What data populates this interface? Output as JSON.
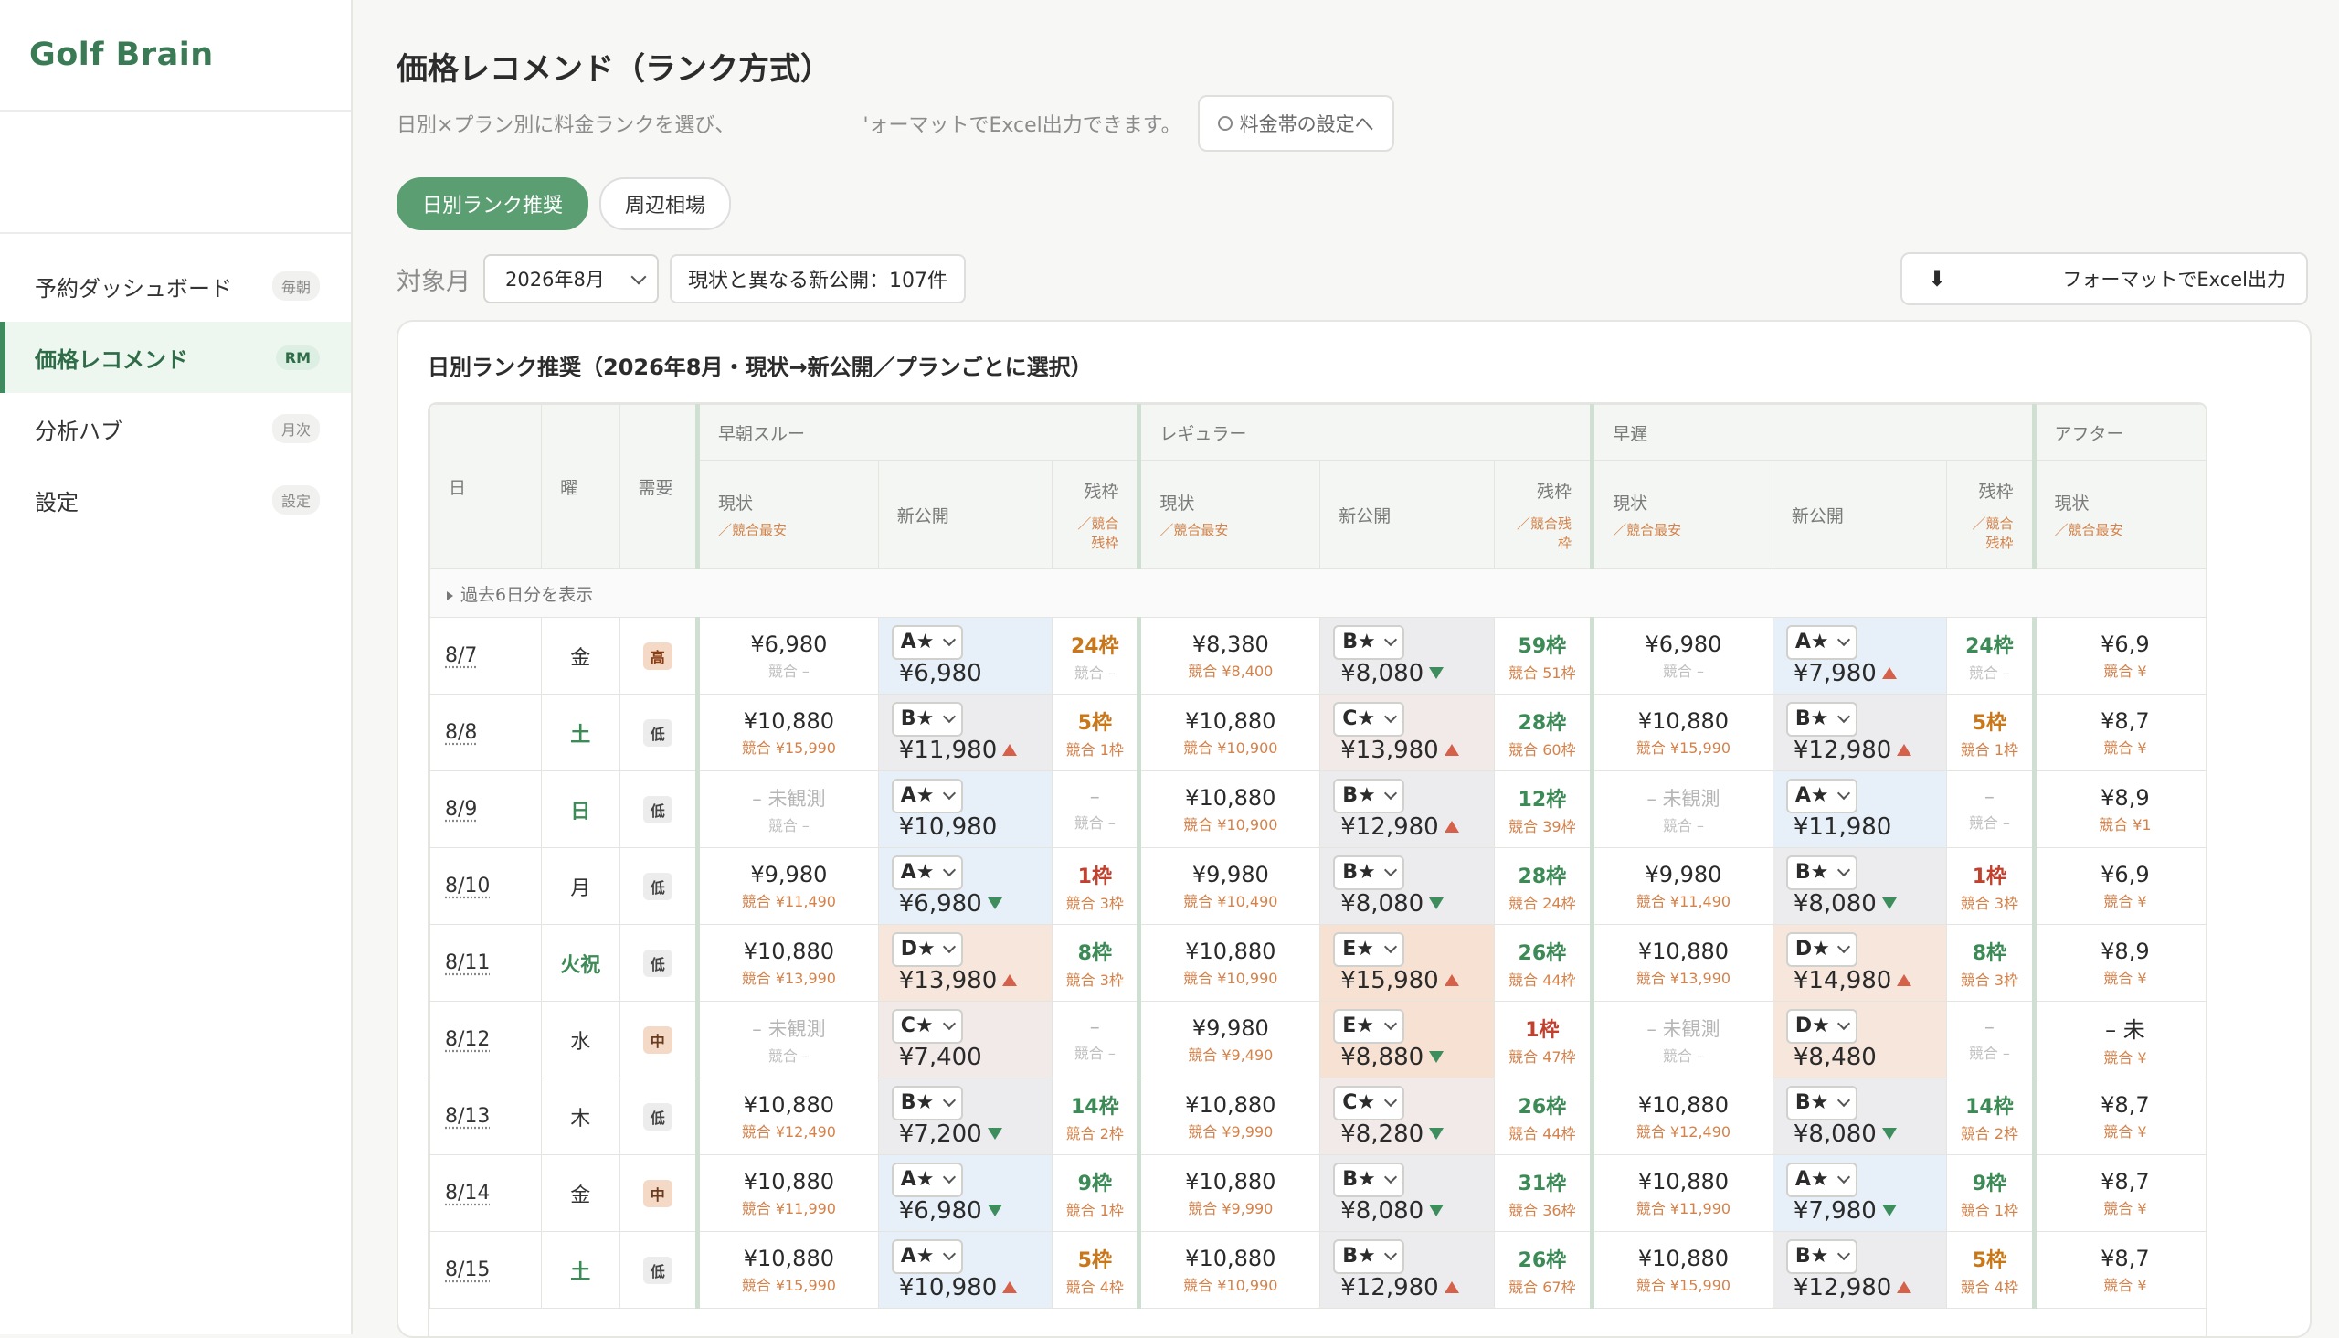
{
  "sidebar": {
    "brand": "Golf Brain",
    "nav": [
      {
        "label": "予約ダッシュボード",
        "badge": "毎朝"
      },
      {
        "label": "価格レコメンド",
        "badge": "RM"
      },
      {
        "label": "分析ハブ",
        "badge": "月次"
      },
      {
        "label": "設定",
        "badge": "設定"
      }
    ]
  },
  "header": {
    "title": "価格レコメンド（ランク方式）",
    "subtitle_part1": "日別×プラン別に料金ランクを選び、",
    "subtitle_part2": "'ォーマットでExcel出力できます。",
    "settings_link": "料金帯の設定へ"
  },
  "tabs": [
    "日別ランク推奨",
    "周辺相場"
  ],
  "filters": {
    "month_label": "対象月",
    "month_value": "2026年8月",
    "new_count": "現状と異なる新公開：107件",
    "export_label": "フォーマットでExcel出力"
  },
  "card": {
    "title": "日別ランク推奨（2026年8月・現状→新公開／プランごとに選択）",
    "head_day": "日",
    "head_dow": "曜",
    "head_demand": "需要",
    "plans": [
      "早朝スルー",
      "レギュラー",
      "早遅",
      "アフター"
    ],
    "sub_current": "現状",
    "sub_current_note": "／競合最安",
    "sub_new": "新公開",
    "sub_remain": "残枠",
    "sub_remain_note": "／競合残枠",
    "collapse_label": "過去6日分を表示"
  },
  "rows": [
    {
      "date": "8/7",
      "dow": "金",
      "dow_color": "",
      "demand": "高",
      "dem_level": "high",
      "p": [
        {
          "cur": "¥6,980",
          "cur_muted": false,
          "comp": "競合 –",
          "comp_muted": true,
          "rank": "A★",
          "tint": "a",
          "price": "¥6,980",
          "arrow": "",
          "rem": "24枠",
          "rem_color": "orange",
          "rem_sub": "競合 –",
          "rem_sub_muted": true
        },
        {
          "cur": "¥8,380",
          "cur_muted": false,
          "comp": "競合 ¥8,400",
          "comp_muted": false,
          "rank": "B★",
          "tint": "b",
          "price": "¥8,080",
          "arrow": "down",
          "rem": "59枠",
          "rem_color": "green",
          "rem_sub": "競合 51枠",
          "rem_sub_muted": false
        },
        {
          "cur": "¥6,980",
          "cur_muted": false,
          "comp": "競合 –",
          "comp_muted": true,
          "rank": "A★",
          "tint": "a",
          "price": "¥7,980",
          "arrow": "up",
          "rem": "24枠",
          "rem_color": "green",
          "rem_sub": "競合 –",
          "rem_sub_muted": true
        },
        {
          "cur": "¥6,9",
          "comp": "競合 ¥"
        }
      ]
    },
    {
      "date": "8/8",
      "dow": "土",
      "dow_color": "green",
      "demand": "低",
      "dem_level": "low",
      "p": [
        {
          "cur": "¥10,880",
          "cur_muted": false,
          "comp": "競合 ¥15,990",
          "comp_muted": false,
          "rank": "B★",
          "tint": "b",
          "price": "¥11,980",
          "arrow": "up",
          "rem": "5枠",
          "rem_color": "orange",
          "rem_sub": "競合 1枠",
          "rem_sub_muted": false
        },
        {
          "cur": "¥10,880",
          "cur_muted": false,
          "comp": "競合 ¥10,900",
          "comp_muted": false,
          "rank": "C★",
          "tint": "c",
          "price": "¥13,980",
          "arrow": "up",
          "rem": "28枠",
          "rem_color": "green",
          "rem_sub": "競合 60枠",
          "rem_sub_muted": false
        },
        {
          "cur": "¥10,880",
          "cur_muted": false,
          "comp": "競合 ¥15,990",
          "comp_muted": false,
          "rank": "B★",
          "tint": "b",
          "price": "¥12,980",
          "arrow": "up",
          "rem": "5枠",
          "rem_color": "orange",
          "rem_sub": "競合 1枠",
          "rem_sub_muted": false
        },
        {
          "cur": "¥8,7",
          "comp": "競合 ¥"
        }
      ]
    },
    {
      "date": "8/9",
      "dow": "日",
      "dow_color": "green",
      "demand": "低",
      "dem_level": "low",
      "p": [
        {
          "cur": "– 未観測",
          "cur_muted": true,
          "comp": "競合 –",
          "comp_muted": true,
          "rank": "A★",
          "tint": "a",
          "price": "¥10,980",
          "arrow": "",
          "rem": "–",
          "rem_color": "muted",
          "rem_sub": "競合 –",
          "rem_sub_muted": true
        },
        {
          "cur": "¥10,880",
          "cur_muted": false,
          "comp": "競合 ¥10,900",
          "comp_muted": false,
          "rank": "B★",
          "tint": "b",
          "price": "¥12,980",
          "arrow": "up",
          "rem": "12枠",
          "rem_color": "green",
          "rem_sub": "競合 39枠",
          "rem_sub_muted": false
        },
        {
          "cur": "– 未観測",
          "cur_muted": true,
          "comp": "競合 –",
          "comp_muted": true,
          "rank": "A★",
          "tint": "a",
          "price": "¥11,980",
          "arrow": "",
          "rem": "–",
          "rem_color": "muted",
          "rem_sub": "競合 –",
          "rem_sub_muted": true
        },
        {
          "cur": "¥8,9",
          "comp": "競合 ¥1"
        }
      ]
    },
    {
      "date": "8/10",
      "dow": "月",
      "dow_color": "",
      "demand": "低",
      "dem_level": "low",
      "p": [
        {
          "cur": "¥9,980",
          "cur_muted": false,
          "comp": "競合 ¥11,490",
          "comp_muted": false,
          "rank": "A★",
          "tint": "a",
          "price": "¥6,980",
          "arrow": "down",
          "rem": "1枠",
          "rem_color": "red",
          "rem_sub": "競合 3枠",
          "rem_sub_muted": false
        },
        {
          "cur": "¥9,980",
          "cur_muted": false,
          "comp": "競合 ¥10,490",
          "comp_muted": false,
          "rank": "B★",
          "tint": "b",
          "price": "¥8,080",
          "arrow": "down",
          "rem": "28枠",
          "rem_color": "green",
          "rem_sub": "競合 24枠",
          "rem_sub_muted": false
        },
        {
          "cur": "¥9,980",
          "cur_muted": false,
          "comp": "競合 ¥11,490",
          "comp_muted": false,
          "rank": "B★",
          "tint": "b",
          "price": "¥8,080",
          "arrow": "down",
          "rem": "1枠",
          "rem_color": "red",
          "rem_sub": "競合 3枠",
          "rem_sub_muted": false
        },
        {
          "cur": "¥6,9",
          "comp": "競合 ¥"
        }
      ]
    },
    {
      "date": "8/11",
      "dow": "火祝",
      "dow_color": "green",
      "demand": "低",
      "dem_level": "low",
      "p": [
        {
          "cur": "¥10,880",
          "cur_muted": false,
          "comp": "競合 ¥13,990",
          "comp_muted": false,
          "rank": "D★",
          "tint": "d",
          "price": "¥13,980",
          "arrow": "up",
          "rem": "8枠",
          "rem_color": "green",
          "rem_sub": "競合 3枠",
          "rem_sub_muted": false
        },
        {
          "cur": "¥10,880",
          "cur_muted": false,
          "comp": "競合 ¥10,990",
          "comp_muted": false,
          "rank": "E★",
          "tint": "e",
          "price": "¥15,980",
          "arrow": "up",
          "rem": "26枠",
          "rem_color": "green",
          "rem_sub": "競合 44枠",
          "rem_sub_muted": false
        },
        {
          "cur": "¥10,880",
          "cur_muted": false,
          "comp": "競合 ¥13,990",
          "comp_muted": false,
          "rank": "D★",
          "tint": "d",
          "price": "¥14,980",
          "arrow": "up",
          "rem": "8枠",
          "rem_color": "green",
          "rem_sub": "競合 3枠",
          "rem_sub_muted": false
        },
        {
          "cur": "¥8,9",
          "comp": "競合 ¥"
        }
      ]
    },
    {
      "date": "8/12",
      "dow": "水",
      "dow_color": "",
      "demand": "中",
      "dem_level": "mid",
      "p": [
        {
          "cur": "– 未観測",
          "cur_muted": true,
          "comp": "競合 –",
          "comp_muted": true,
          "rank": "C★",
          "tint": "c",
          "price": "¥7,400",
          "arrow": "",
          "rem": "–",
          "rem_color": "muted",
          "rem_sub": "競合 –",
          "rem_sub_muted": true
        },
        {
          "cur": "¥9,980",
          "cur_muted": false,
          "comp": "競合 ¥9,490",
          "comp_muted": false,
          "rank": "E★",
          "tint": "e",
          "price": "¥8,880",
          "arrow": "down",
          "rem": "1枠",
          "rem_color": "red",
          "rem_sub": "競合 47枠",
          "rem_sub_muted": false
        },
        {
          "cur": "– 未観測",
          "cur_muted": true,
          "comp": "競合 –",
          "comp_muted": true,
          "rank": "D★",
          "tint": "d",
          "price": "¥8,480",
          "arrow": "",
          "rem": "–",
          "rem_color": "muted",
          "rem_sub": "競合 –",
          "rem_sub_muted": true
        },
        {
          "cur": "– 未",
          "comp": "競合 ¥"
        }
      ]
    },
    {
      "date": "8/13",
      "dow": "木",
      "dow_color": "",
      "demand": "低",
      "dem_level": "low",
      "p": [
        {
          "cur": "¥10,880",
          "cur_muted": false,
          "comp": "競合 ¥12,490",
          "comp_muted": false,
          "rank": "B★",
          "tint": "b",
          "price": "¥7,200",
          "arrow": "down",
          "rem": "14枠",
          "rem_color": "green",
          "rem_sub": "競合 2枠",
          "rem_sub_muted": false
        },
        {
          "cur": "¥10,880",
          "cur_muted": false,
          "comp": "競合 ¥9,990",
          "comp_muted": false,
          "rank": "C★",
          "tint": "c",
          "price": "¥8,280",
          "arrow": "down",
          "rem": "26枠",
          "rem_color": "green",
          "rem_sub": "競合 44枠",
          "rem_sub_muted": false
        },
        {
          "cur": "¥10,880",
          "cur_muted": false,
          "comp": "競合 ¥12,490",
          "comp_muted": false,
          "rank": "B★",
          "tint": "b",
          "price": "¥8,080",
          "arrow": "down",
          "rem": "14枠",
          "rem_color": "green",
          "rem_sub": "競合 2枠",
          "rem_sub_muted": false
        },
        {
          "cur": "¥8,7",
          "comp": "競合 ¥"
        }
      ]
    },
    {
      "date": "8/14",
      "dow": "金",
      "dow_color": "",
      "demand": "中",
      "dem_level": "mid",
      "p": [
        {
          "cur": "¥10,880",
          "cur_muted": false,
          "comp": "競合 ¥11,990",
          "comp_muted": false,
          "rank": "A★",
          "tint": "a",
          "price": "¥6,980",
          "arrow": "down",
          "rem": "9枠",
          "rem_color": "green",
          "rem_sub": "競合 1枠",
          "rem_sub_muted": false
        },
        {
          "cur": "¥10,880",
          "cur_muted": false,
          "comp": "競合 ¥9,990",
          "comp_muted": false,
          "rank": "B★",
          "tint": "b",
          "price": "¥8,080",
          "arrow": "down",
          "rem": "31枠",
          "rem_color": "green",
          "rem_sub": "競合 36枠",
          "rem_sub_muted": false
        },
        {
          "cur": "¥10,880",
          "cur_muted": false,
          "comp": "競合 ¥11,990",
          "comp_muted": false,
          "rank": "A★",
          "tint": "a",
          "price": "¥7,980",
          "arrow": "down",
          "rem": "9枠",
          "rem_color": "green",
          "rem_sub": "競合 1枠",
          "rem_sub_muted": false
        },
        {
          "cur": "¥8,7",
          "comp": "競合 ¥"
        }
      ]
    },
    {
      "date": "8/15",
      "dow": "土",
      "dow_color": "green",
      "demand": "低",
      "dem_level": "low",
      "p": [
        {
          "cur": "¥10,880",
          "cur_muted": false,
          "comp": "競合 ¥15,990",
          "comp_muted": false,
          "rank": "A★",
          "tint": "a",
          "price": "¥10,980",
          "arrow": "up",
          "rem": "5枠",
          "rem_color": "orange",
          "rem_sub": "競合 4枠",
          "rem_sub_muted": false
        },
        {
          "cur": "¥10,880",
          "cur_muted": false,
          "comp": "競合 ¥10,990",
          "comp_muted": false,
          "rank": "B★",
          "tint": "b",
          "price": "¥12,980",
          "arrow": "up",
          "rem": "26枠",
          "rem_color": "green",
          "rem_sub": "競合 67枠",
          "rem_sub_muted": false
        },
        {
          "cur": "¥10,880",
          "cur_muted": false,
          "comp": "競合 ¥15,990",
          "comp_muted": false,
          "rank": "B★",
          "tint": "b",
          "price": "¥12,980",
          "arrow": "up",
          "rem": "5枠",
          "rem_color": "orange",
          "rem_sub": "競合 4枠",
          "rem_sub_muted": false
        },
        {
          "cur": "¥8,7",
          "comp": "競合 ¥"
        }
      ]
    }
  ],
  "colors": {
    "accent": "#5a9e72",
    "brand": "#3a7a55",
    "up_arrow": "#d5614a",
    "down_arrow": "#3d8e5c",
    "remain_green": "#3c8a56",
    "remain_orange": "#c97718",
    "remain_red": "#c2412e"
  },
  "icons": {
    "settings": "gear-icon",
    "download": "download-arrow-icon",
    "expand": "triangle-right-icon",
    "select": "chevron-down-icon",
    "price_up": "arrow-up-icon",
    "price_down": "arrow-down-icon"
  }
}
